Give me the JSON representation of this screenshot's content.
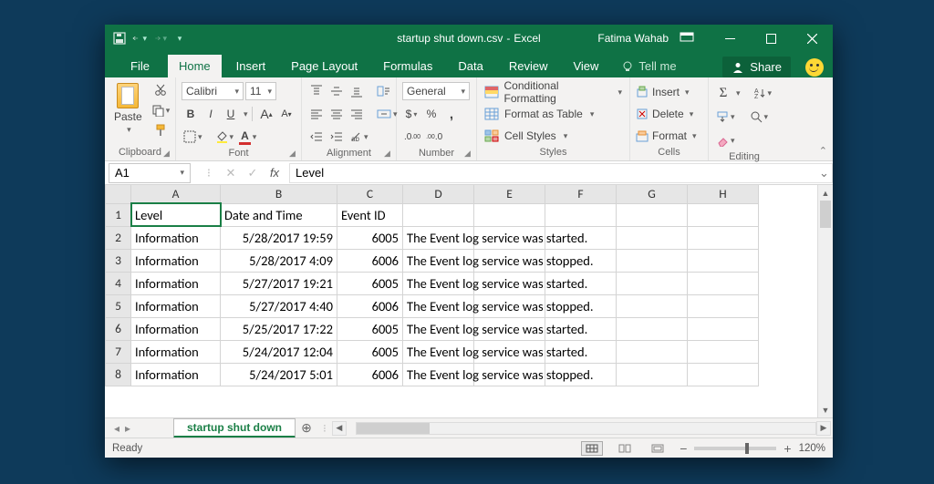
{
  "titlebar": {
    "filename": "startup shut down.csv",
    "app": "Excel",
    "separator": " - ",
    "user": "Fatima Wahab"
  },
  "tabs": {
    "file": "File",
    "items": [
      "Home",
      "Insert",
      "Page Layout",
      "Formulas",
      "Data",
      "Review",
      "View"
    ],
    "active": "Home",
    "tellme": "Tell me",
    "share": "Share"
  },
  "clipboard": {
    "label": "Clipboard",
    "paste": "Paste"
  },
  "font": {
    "label": "Font",
    "name": "Calibri",
    "size": "11",
    "bold": "B",
    "italic": "I",
    "underline": "U",
    "incA": "A",
    "decA": "A"
  },
  "alignment": {
    "label": "Alignment"
  },
  "number": {
    "label": "Number",
    "format": "General",
    "currency": "$",
    "percent": "%",
    "comma": ","
  },
  "styles": {
    "label": "Styles",
    "cond": "Conditional Formatting",
    "tbl": "Format as Table",
    "cell": "Cell Styles"
  },
  "cells": {
    "label": "Cells",
    "insert": "Insert",
    "delete": "Delete",
    "format": "Format"
  },
  "editing": {
    "label": "Editing",
    "autosum": "Σ",
    "sort": "A",
    "find": "ρ"
  },
  "namebox": "A1",
  "formula": "Level",
  "columns": [
    "A",
    "B",
    "C",
    "D",
    "E",
    "F",
    "G",
    "H"
  ],
  "rows": [
    {
      "n": "1",
      "a": "Level",
      "b": "Date and Time",
      "c": "Event ID",
      "cn": false,
      "d": ""
    },
    {
      "n": "2",
      "a": "Information",
      "b": "5/28/2017 19:59",
      "c": "6005",
      "cn": true,
      "d": "The Event log service was started."
    },
    {
      "n": "3",
      "a": "Information",
      "b": "5/28/2017 4:09",
      "c": "6006",
      "cn": true,
      "d": "The Event log service was stopped."
    },
    {
      "n": "4",
      "a": "Information",
      "b": "5/27/2017 19:21",
      "c": "6005",
      "cn": true,
      "d": "The Event log service was started."
    },
    {
      "n": "5",
      "a": "Information",
      "b": "5/27/2017 4:40",
      "c": "6006",
      "cn": true,
      "d": "The Event log service was stopped."
    },
    {
      "n": "6",
      "a": "Information",
      "b": "5/25/2017 17:22",
      "c": "6005",
      "cn": true,
      "d": "The Event log service was started."
    },
    {
      "n": "7",
      "a": "Information",
      "b": "5/24/2017 12:04",
      "c": "6005",
      "cn": true,
      "d": "The Event log service was started."
    },
    {
      "n": "8",
      "a": "Information",
      "b": "5/24/2017 5:01",
      "c": "6006",
      "cn": true,
      "d": "The Event log service was stopped."
    }
  ],
  "colwidths": {
    "A": 98,
    "B": 128,
    "C": 72,
    "D": 78,
    "E": 78,
    "F": 78,
    "G": 78,
    "H": 78
  },
  "sheet": {
    "name": "startup shut down"
  },
  "status": {
    "ready": "Ready",
    "zoom": "120%"
  }
}
